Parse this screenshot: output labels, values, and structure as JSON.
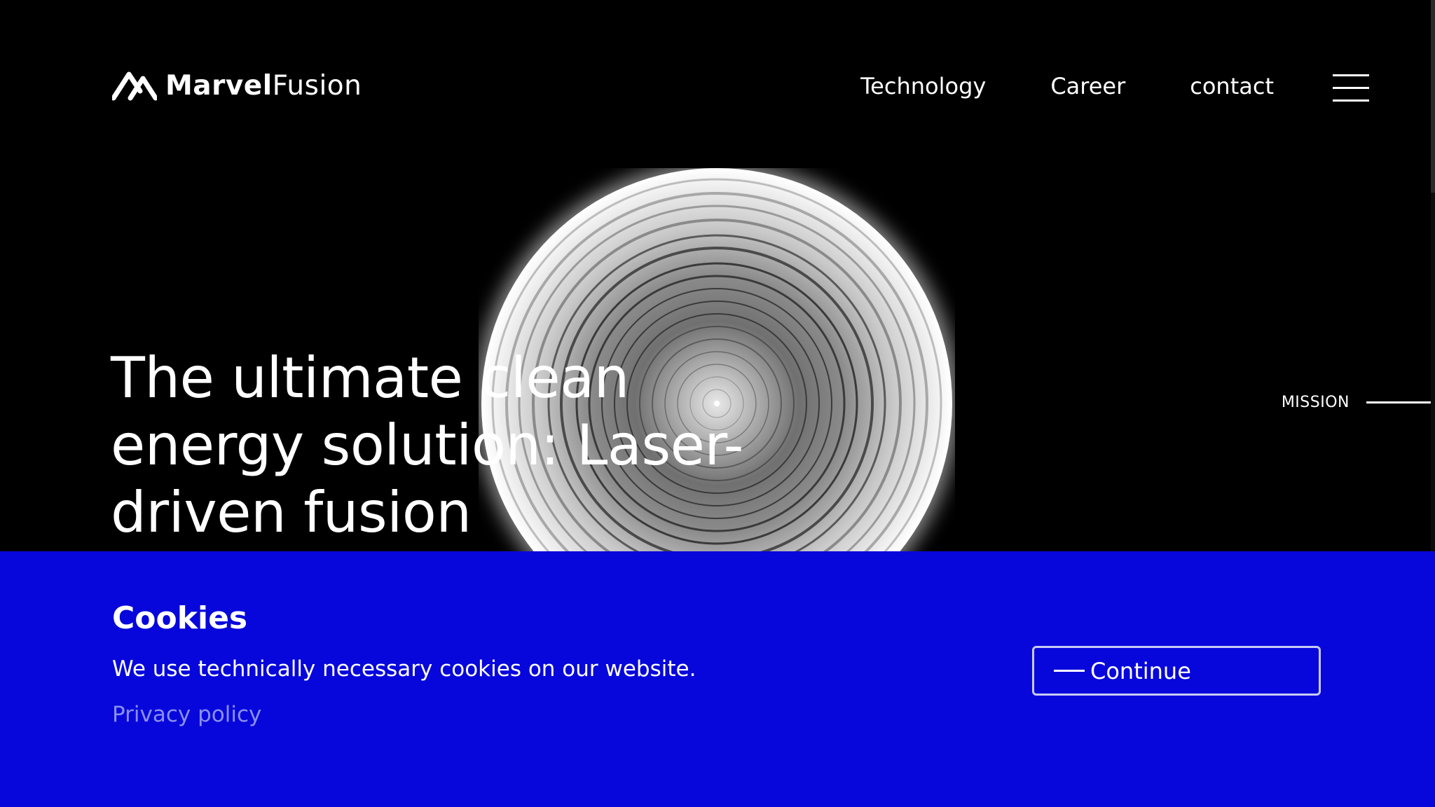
{
  "brand": {
    "name_bold": "Marvel",
    "name_light": "Fusion"
  },
  "nav": {
    "items": [
      {
        "label": "Technology"
      },
      {
        "label": "Career"
      },
      {
        "label": "contact"
      }
    ],
    "menu_icon": "hamburger-menu-icon"
  },
  "hero": {
    "title": "The ultimate clean energy solution: Laser-driven fusion",
    "side_label": "MISSION"
  },
  "cookie_banner": {
    "title": "Cookies",
    "text": "We use technically necessary cookies on our website.",
    "privacy_link": "Privacy policy",
    "continue_label": "Continue"
  },
  "colors": {
    "background": "#000000",
    "banner": "#0707dc",
    "text": "#ffffff",
    "privacy_link": "#8b8fee"
  }
}
